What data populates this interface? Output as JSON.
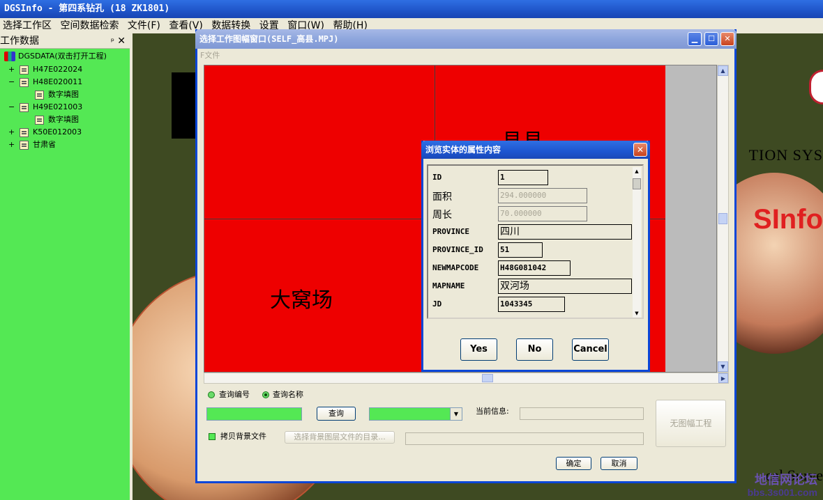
{
  "app": {
    "title": "DGSInfo - 第四系钻孔 (18  ZK1801)"
  },
  "menubar": [
    "选择工作区",
    "空间数据检索",
    "文件(F)",
    "查看(V)",
    "数据转换",
    "设置",
    "窗口(W)",
    "帮助(H)"
  ],
  "left_panel": {
    "title": "工作数据",
    "pin": "ᵖ",
    "close": "✕",
    "tree": [
      {
        "label": "DGSDATA(双击打开工程)",
        "expander": "",
        "icon": "database-icon"
      },
      {
        "label": "H47E022024",
        "expander": "+",
        "icon": "map-file-icon"
      },
      {
        "label": "H48E020011",
        "expander": "−",
        "icon": "map-file-icon"
      },
      {
        "label": "数字填图",
        "expander": "",
        "icon": "map-file-icon"
      },
      {
        "label": "H49E021003",
        "expander": "−",
        "icon": "map-file-icon"
      },
      {
        "label": "数字填图",
        "expander": "",
        "icon": "map-file-icon"
      },
      {
        "label": "K50E012003",
        "expander": "+",
        "icon": "map-file-icon"
      },
      {
        "label": "甘肃省",
        "expander": "+",
        "icon": "map-file-icon"
      }
    ]
  },
  "background": {
    "tionsys": "TION SYS",
    "sinfo": "SInfo",
    "surve": "cal Surve",
    "watermark_top": "地信网论坛",
    "watermark_bottom": "bbs.3s001.com"
  },
  "map_window": {
    "title": "选择工作图幅窗口(SELF_高县.MPJ)",
    "submenu": "F文件",
    "map_labels": {
      "top": "县县",
      "left": "大窝场"
    },
    "radio_number": "查询编号",
    "radio_name": "查询名称",
    "query_button": "查询",
    "current_info_label": "当前信息:",
    "no_map_button": "无图幅工程",
    "copy_bg_label": "拷贝背景文件",
    "select_bg_button": "选择背景图层文件的目录...",
    "ok_button": "确定",
    "cancel_button": "取消",
    "dropdown_arrow": "▼"
  },
  "dialog": {
    "title": "浏览实体的属性内容",
    "close": "✕",
    "properties": [
      {
        "name": "ID",
        "value": "1",
        "style": "normal"
      },
      {
        "name": "面积",
        "value": "294.000000",
        "style": "gray"
      },
      {
        "name": "周长",
        "value": "70.000000",
        "style": "gray"
      },
      {
        "name": "PROVINCE",
        "value": "四川",
        "style": "cn"
      },
      {
        "name": "PROVINCE_ID",
        "value": "51",
        "style": "normal"
      },
      {
        "name": "NEWMAPCODE",
        "value": "H48G081042",
        "style": "normal"
      },
      {
        "name": "MAPNAME",
        "value": "双河场",
        "style": "cn"
      },
      {
        "name": "JD",
        "value": "1043345",
        "style": "normal"
      }
    ],
    "yes": "Yes",
    "no": "No",
    "cancel": "Cancel"
  },
  "colors": {
    "accent": "#0a46d8",
    "tree_bg": "#54e854",
    "map_fill": "#ee0000"
  }
}
